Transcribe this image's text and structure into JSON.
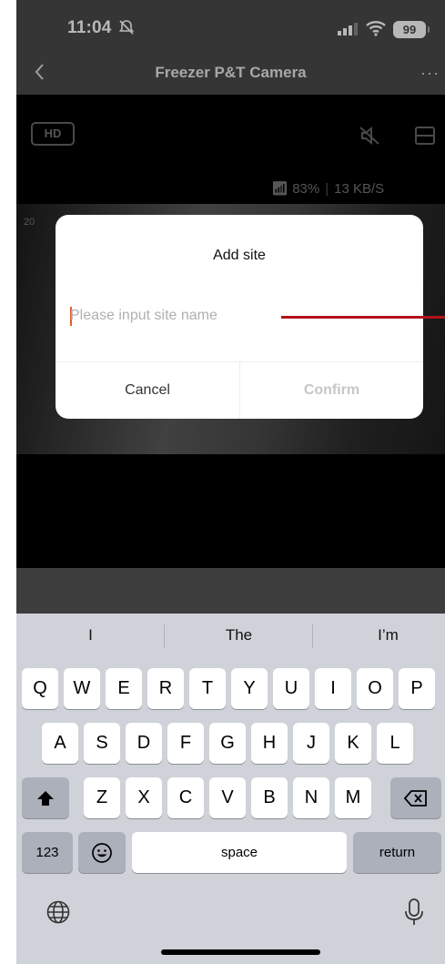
{
  "status": {
    "time": "11:04",
    "battery": "99"
  },
  "nav": {
    "title": "Freezer P&T Camera",
    "more": "···"
  },
  "video": {
    "quality_badge": "HD",
    "signal": "83%",
    "speed": "13 KB/S",
    "timestamp": "20"
  },
  "dialog": {
    "title": "Add site",
    "input_placeholder": "Please input site name",
    "input_value": "",
    "cancel_label": "Cancel",
    "confirm_label": "Confirm"
  },
  "keyboard": {
    "suggestions": [
      "I",
      "The",
      "I’m"
    ],
    "row1": [
      "Q",
      "W",
      "E",
      "R",
      "T",
      "Y",
      "U",
      "I",
      "O",
      "P"
    ],
    "row2": [
      "A",
      "S",
      "D",
      "F",
      "G",
      "H",
      "J",
      "K",
      "L"
    ],
    "row3": [
      "Z",
      "X",
      "C",
      "V",
      "B",
      "N",
      "M"
    ],
    "numbers_label": "123",
    "space_label": "space",
    "return_label": "return"
  },
  "colors": {
    "accent_caret": "#e8592c",
    "annotation_line": "#b3121a",
    "confirm_disabled": "#c7c7c7"
  }
}
